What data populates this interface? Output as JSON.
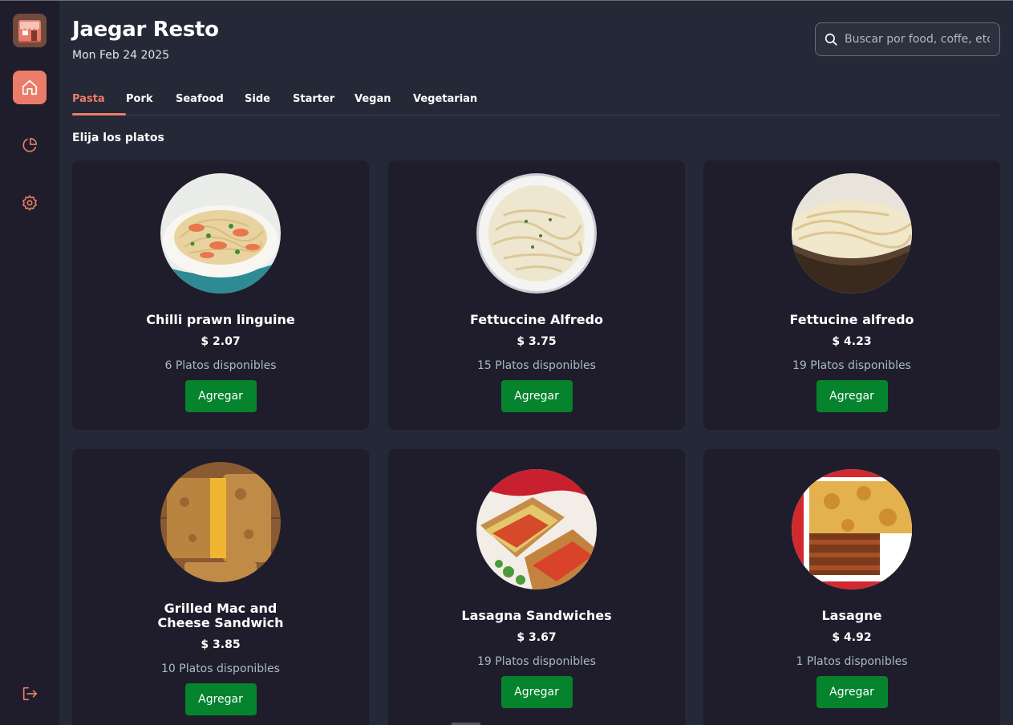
{
  "app": {
    "title": "Jaegar Resto",
    "date": "Mon Feb 24 2025",
    "accent_color": "#ea7c69",
    "button_color": "#05832d"
  },
  "sidebar": {
    "items": [
      {
        "name": "store-logo",
        "icon": "store-icon"
      },
      {
        "name": "home",
        "icon": "home-icon",
        "active": true
      },
      {
        "name": "dashboard",
        "icon": "pie-chart-icon"
      },
      {
        "name": "settings",
        "icon": "gear-icon"
      },
      {
        "name": "logout",
        "icon": "logout-icon"
      }
    ]
  },
  "search": {
    "placeholder": "Buscar por food, coffe, etc",
    "icon": "search-icon"
  },
  "tabs": [
    {
      "label": "Pasta",
      "active": true
    },
    {
      "label": "Pork"
    },
    {
      "label": "Seafood"
    },
    {
      "label": "Side"
    },
    {
      "label": "Starter"
    },
    {
      "label": "Vegan"
    },
    {
      "label": "Vegetarian"
    }
  ],
  "section_title": "Elija los platos",
  "dishes": [
    {
      "name": "Chilli prawn linguine",
      "price": "$ 2.07",
      "stock": "6 Platos disponibles",
      "button": "Agregar"
    },
    {
      "name": "Fettuccine Alfredo",
      "price": "$ 3.75",
      "stock": "15 Platos disponibles",
      "button": "Agregar"
    },
    {
      "name": "Fettucine alfredo",
      "price": "$ 4.23",
      "stock": "19 Platos disponibles",
      "button": "Agregar"
    },
    {
      "name": "Grilled Mac and Cheese Sandwich",
      "price": "$ 3.85",
      "stock": "10 Platos disponibles",
      "button": "Agregar"
    },
    {
      "name": "Lasagna Sandwiches",
      "price": "$ 3.67",
      "stock": "19 Platos disponibles",
      "button": "Agregar"
    },
    {
      "name": "Lasagne",
      "price": "$ 4.92",
      "stock": "1 Platos disponibles",
      "button": "Agregar"
    }
  ]
}
